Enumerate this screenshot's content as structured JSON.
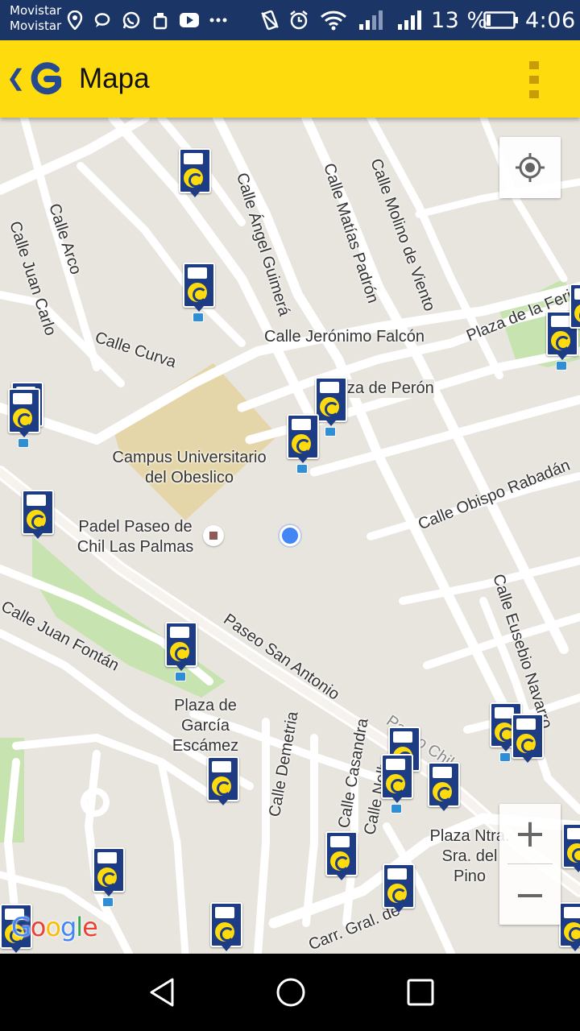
{
  "status_bar": {
    "carrier_line1": "Movistar",
    "carrier_line2": "Movistar",
    "battery": "13 %",
    "time": "4:06",
    "icons": [
      "location-pin-icon",
      "chat-bubble-icon",
      "whatsapp-icon",
      "cleaner-icon",
      "youtube-icon",
      "more-dots-icon",
      "vibrate-icon",
      "alarm-icon",
      "wifi-icon",
      "signal-icon",
      "signal-icon",
      "battery-icon"
    ]
  },
  "app_bar": {
    "title": "Mapa",
    "logo": "guaguas-logo",
    "menu_icon": "overflow-menu-icon",
    "brand_color": "#fedb0d"
  },
  "map": {
    "streets": [
      "Calle Arco",
      "Calle Juan Carlo",
      "Calle Ángel Guimerá",
      "Calle Matías Padrón",
      "Calle Molino de Viento",
      "Plaza de la Feria",
      "Calle Curva",
      "Calle Jerónimo Falcón",
      "Plaza de Perón",
      "Calle Obispo Rabadán",
      "Calle Juan Fontán",
      "Paseo San Antonio",
      "Calle Eusebio Navarro",
      "Calle Demetria",
      "Calle Casandra",
      "Calle Nelly",
      "Paseo Chil",
      "Carr. Gral. de"
    ],
    "places": {
      "campus": "Campus Universitario del Obeslico",
      "padel": "Padel Paseo de Chil Las Palmas",
      "plaza_garcia": "Plaza de García Escámez",
      "plaza_pino": "Plaza Ntra. Sra. del Pino"
    },
    "controls": {
      "my_location": "my-location-icon",
      "zoom_in": "+",
      "zoom_out": "−"
    },
    "attribution": "Google",
    "stop_marker_color": "#1e3c84",
    "user_location_color": "#4285f4"
  },
  "nav_bar": {
    "back": "back-triangle-icon",
    "home": "home-circle-icon",
    "recents": "recents-square-icon"
  }
}
